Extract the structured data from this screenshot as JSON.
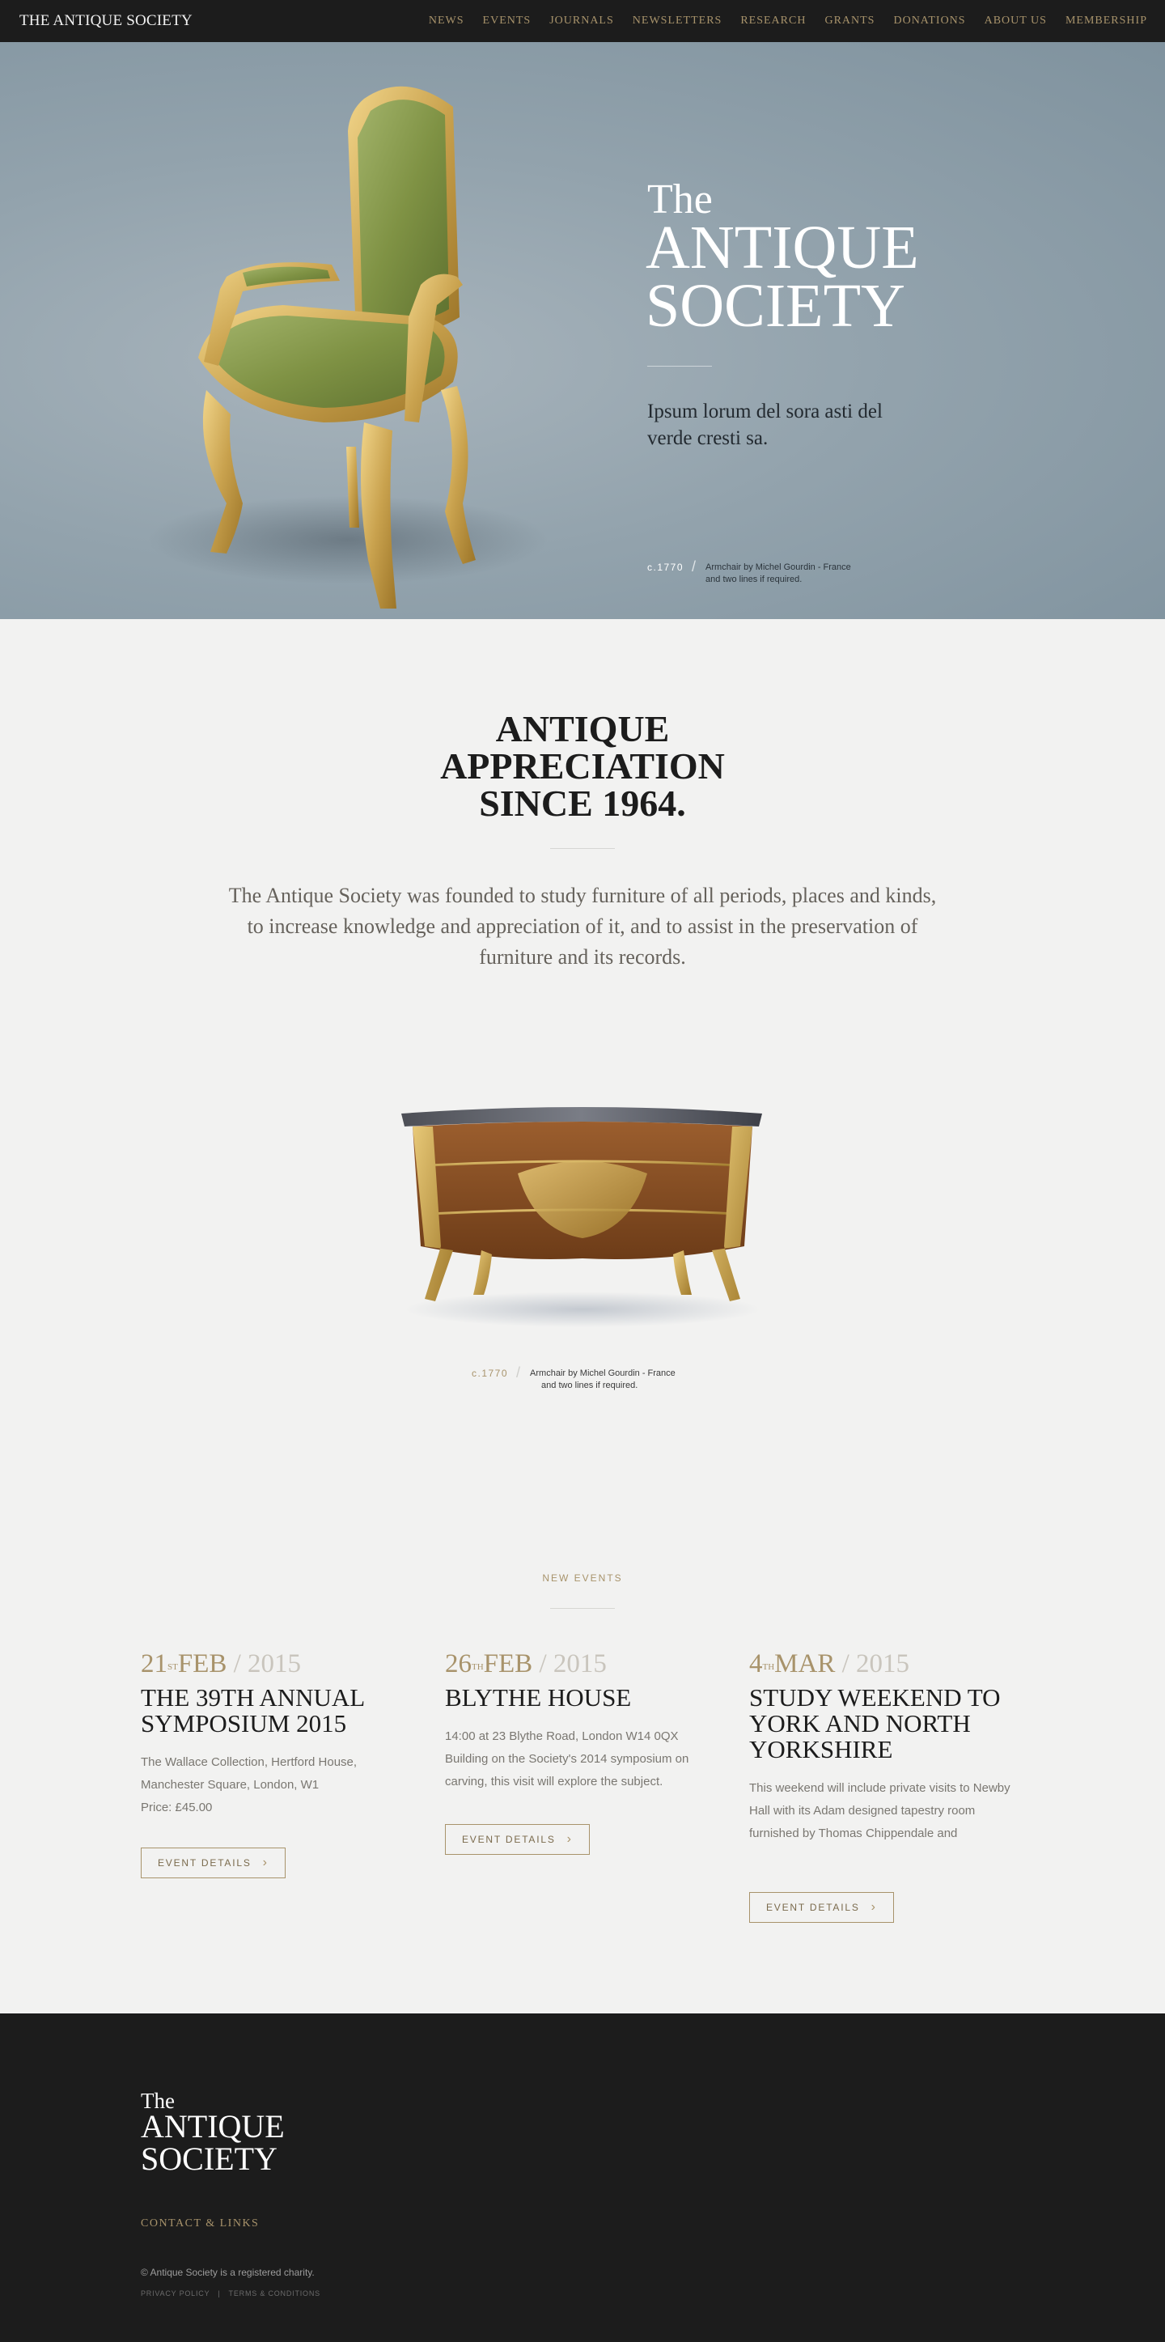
{
  "header": {
    "brand": "THE ANTIQUE SOCIETY",
    "nav": [
      "NEWS",
      "EVENTS",
      "JOURNALS",
      "NEWSLETTERS",
      "RESEARCH",
      "GRANTS",
      "DONATIONS",
      "ABOUT US",
      "MEMBERSHIP"
    ]
  },
  "hero": {
    "title_small": "The",
    "title_line1": "ANTIQUE",
    "title_line2": "SOCIETY",
    "subtitle": "Ipsum lorum del sora asti del verde cresti sa.",
    "caption_year": "c.1770",
    "caption_text_line1": "Armchair by Michel Gourdin - France",
    "caption_text_line2": "and two lines if required."
  },
  "intro": {
    "title_line1": "ANTIQUE",
    "title_line2": "APPRECIATION",
    "title_line3": "SINCE 1964.",
    "text": "The Antique Society was founded to study furniture of all periods, places and kinds, to increase knowledge and appreciation of it, and to assist in the preservation of furniture and its records.",
    "caption_year": "c.1770",
    "caption_text_line1": "Armchair by Michel Gourdin - France",
    "caption_text_line2": "and two lines if required."
  },
  "events": {
    "heading": "NEW EVENTS",
    "items": [
      {
        "day": "21",
        "suffix": "ST",
        "month": "FEB",
        "year": "2015",
        "title": "THE 39TH ANNUAL SYMPOSIUM 2015",
        "desc": "The Wallace Collection, Hertford House, Manchester Square, London, W1",
        "price": "Price: £45.00",
        "button": "EVENT DETAILS"
      },
      {
        "day": "26",
        "suffix": "TH",
        "month": "FEB",
        "year": "2015",
        "title": "BLYTHE HOUSE",
        "desc": "14:00 at 23 Blythe Road, London W14 0QX Building on the Society's 2014 symposium on carving, this visit will explore the subject.",
        "price": "",
        "button": "EVENT DETAILS"
      },
      {
        "day": "4",
        "suffix": "TH",
        "month": "MAR",
        "year": "2015",
        "title": "STUDY WEEKEND TO YORK AND NORTH YORKSHIRE",
        "desc": "This weekend will include private visits to Newby Hall with its Adam designed tapestry room furnished by Thomas Chippendale and",
        "price": "",
        "button": "EVENT DETAILS"
      }
    ]
  },
  "footer": {
    "title_small": "The",
    "title_line1": "ANTIQUE",
    "title_line2": "SOCIETY",
    "contact": "CONTACT & LINKS",
    "charity": "© Antique Society is a registered charity.",
    "privacy": "PRIVACY POLICY",
    "separator": "|",
    "terms": "TERMS & CONDITIONS"
  },
  "colors": {
    "accent": "#a8936b",
    "dark": "#1c1c1c",
    "hero_bg": "#93a3ad",
    "page_bg": "#f2f2f1"
  }
}
